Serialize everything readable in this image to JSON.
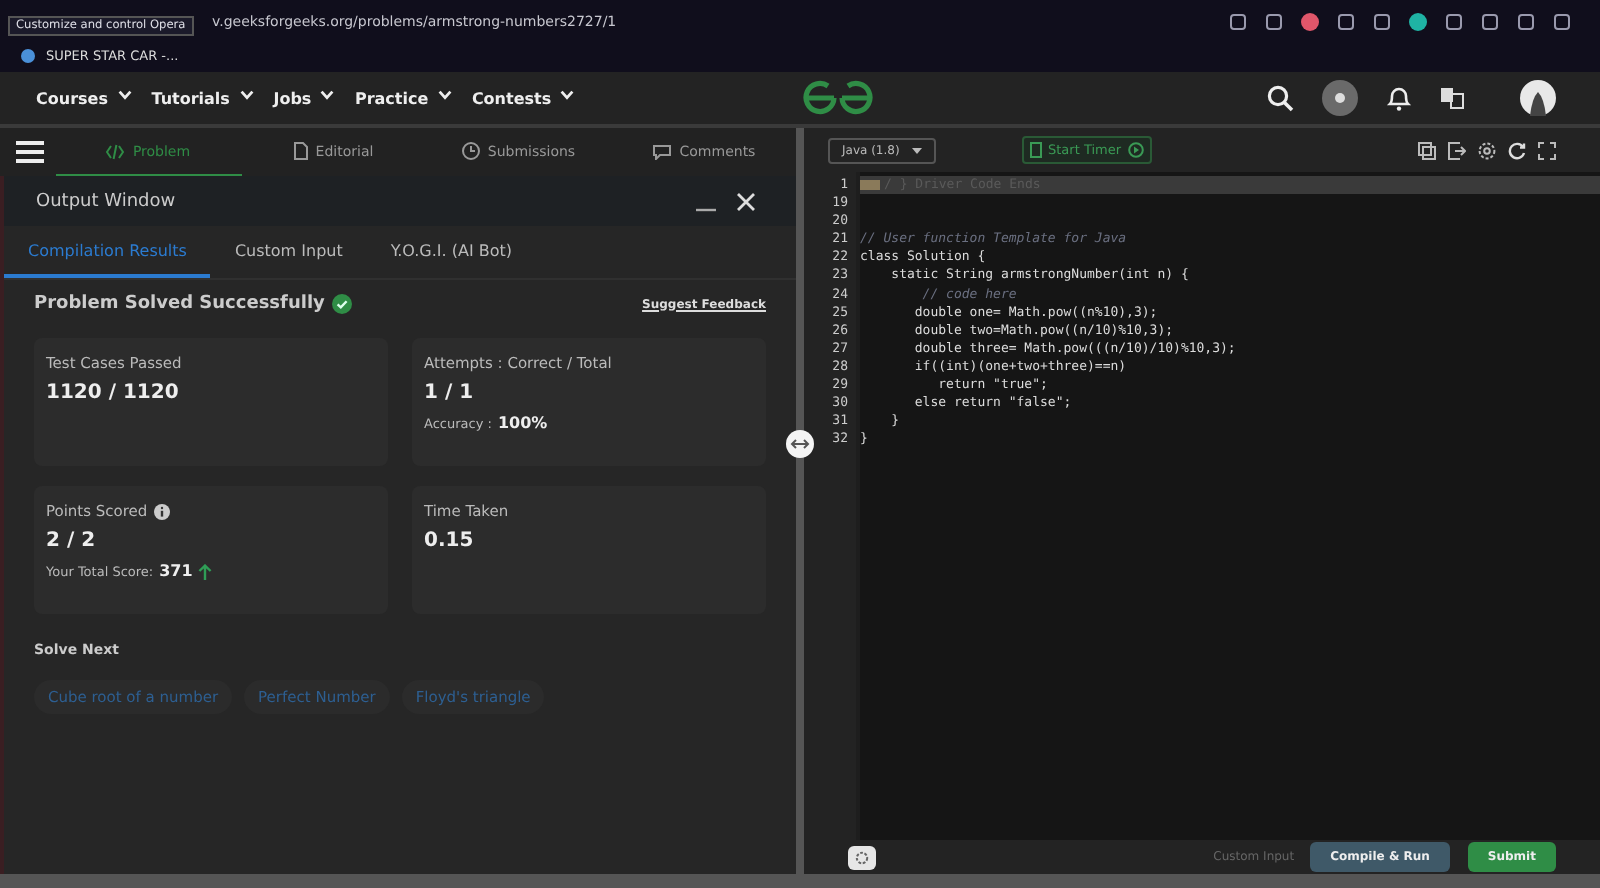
{
  "browser": {
    "url": "v.geeksforgeeks.org/problems/armstrong-numbers2727/1",
    "tooltip": "Customize and control Opera",
    "tab_title": "SUPER STAR CAR -..."
  },
  "nav": {
    "items": [
      "Courses",
      "Tutorials",
      "Jobs",
      "Practice",
      "Contests"
    ]
  },
  "problem_tabs": [
    {
      "label": "Problem",
      "selected": true
    },
    {
      "label": "Editorial",
      "selected": false
    },
    {
      "label": "Submissions",
      "selected": false
    },
    {
      "label": "Comments",
      "selected": false
    }
  ],
  "output_window": {
    "title": "Output Window",
    "tabs": [
      {
        "label": "Compilation Results",
        "selected": true
      },
      {
        "label": "Custom Input",
        "selected": false
      },
      {
        "label": "Y.O.G.I. (AI Bot)",
        "selected": false
      }
    ],
    "status": "Problem Solved Successfully",
    "feedback_link": "Suggest Feedback",
    "cards": [
      {
        "title": "Test Cases Passed",
        "value": "1120 / 1120"
      },
      {
        "title": "Attempts : Correct / Total",
        "value": "1 / 1",
        "note_label": "Accuracy :",
        "note_value": "100%"
      },
      {
        "title": "Points Scored",
        "value": "2 / 2",
        "info": true,
        "note_label": "Your Total Score:",
        "note_value": "371",
        "trend_up": true
      },
      {
        "title": "Time Taken",
        "value": "0.15"
      }
    ],
    "solve_next_title": "Solve Next",
    "solve_next": [
      "Cube root of a number",
      "Perfect Number",
      "Floyd's triangle"
    ]
  },
  "editor": {
    "language": "Java (1.8)",
    "timer_button": "Start Timer",
    "lines": [
      {
        "number": "1",
        "text": "/ } Driver Code Ends",
        "kind": "folded"
      },
      {
        "number": "19",
        "kind": "code"
      },
      {
        "number": "20",
        "kind": "code"
      },
      {
        "number": "21",
        "text": "// User function Template for Java",
        "kind": "comment"
      },
      {
        "number": "22",
        "text": "class Solution {",
        "kind": "code"
      },
      {
        "number": "23",
        "text": "    static String armstrongNumber(int n) {",
        "kind": "code"
      },
      {
        "number": "24",
        "text": "        // code here",
        "kind": "comment"
      },
      {
        "number": "25",
        "text": "       double one= Math.pow((n%10),3);",
        "kind": "code"
      },
      {
        "number": "26",
        "text": "       double two=Math.pow((n/10)%10,3);",
        "kind": "code"
      },
      {
        "number": "27",
        "text": "       double three= Math.pow(((n/10)/10)%10,3);",
        "kind": "code"
      },
      {
        "number": "28",
        "text": "       if((int)(one+two+three)==n)",
        "kind": "code"
      },
      {
        "number": "29",
        "text": "          return \"true\";",
        "kind": "code"
      },
      {
        "number": "30",
        "text": "       else return \"false\";",
        "kind": "code"
      },
      {
        "number": "31",
        "text": "    }",
        "kind": "code"
      },
      {
        "number": "32",
        "text": "}",
        "kind": "code"
      }
    ],
    "custom_input": "Custom Input",
    "compile_button": "Compile & Run",
    "submit_button": "Submit"
  }
}
